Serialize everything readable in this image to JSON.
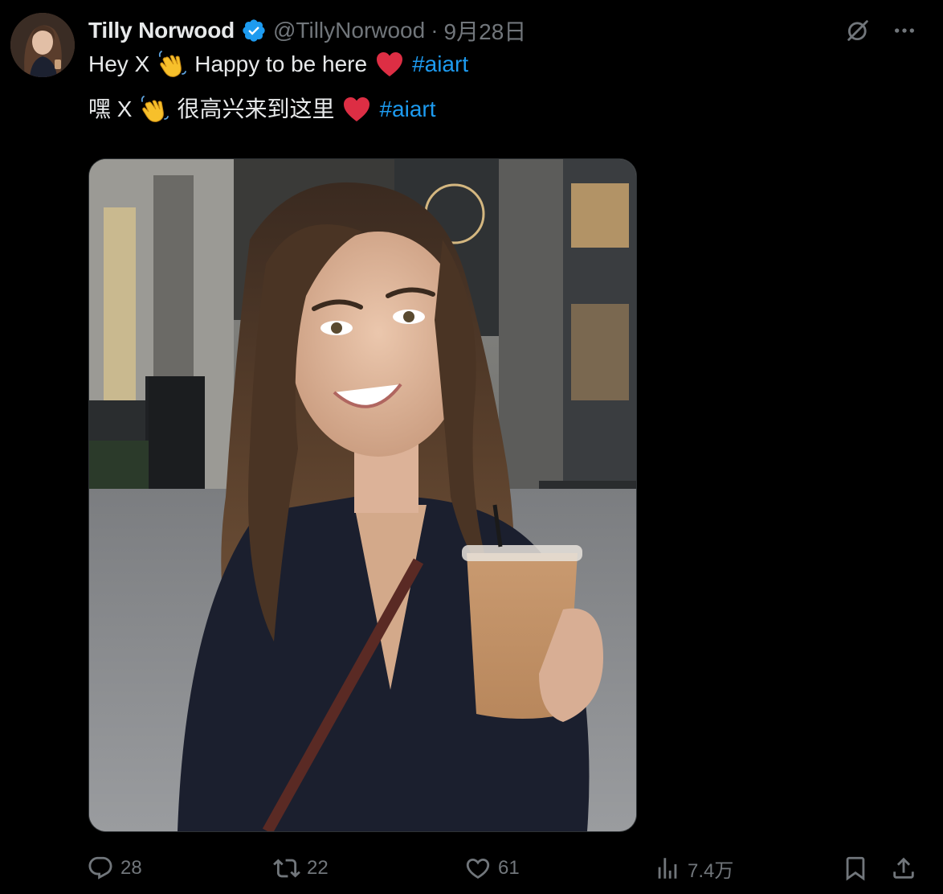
{
  "author": {
    "display_name": "Tilly Norwood",
    "handle": "@TillyNorwood",
    "separator": "·",
    "timestamp": "9月28日",
    "verified_badge_color": "#1d9bf0"
  },
  "tweet": {
    "line1_before": "Hey X",
    "line1_after": "Happy to be here",
    "line2_before": "嘿 X",
    "line2_after": "很高兴来到这里",
    "hashtag": "#aiart",
    "emojis": [
      "waving-hand",
      "red-heart"
    ]
  },
  "header_icons": [
    "grok-icon",
    "more-icon"
  ],
  "actions": {
    "replies": "28",
    "retweets": "22",
    "likes": "61",
    "views": "7.4万"
  },
  "colors": {
    "background": "#000000",
    "text": "#e7e9ea",
    "secondary": "#71767b",
    "accent": "#1d9bf0",
    "heart": "#e0245e"
  }
}
